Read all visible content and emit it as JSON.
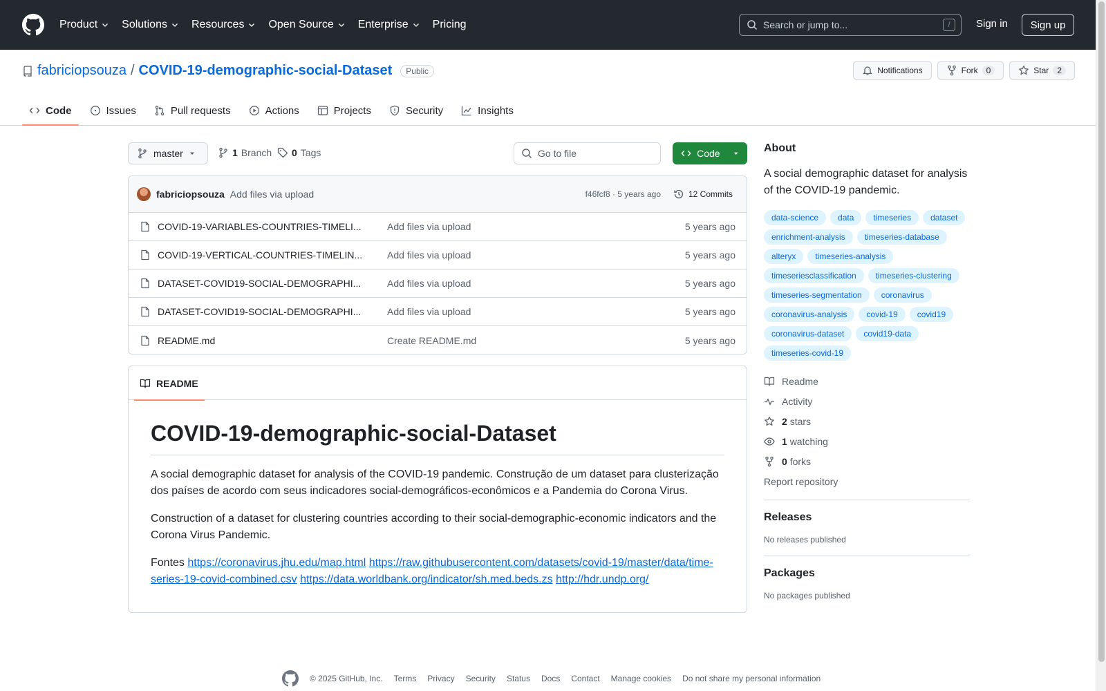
{
  "nav": {
    "items": [
      "Product",
      "Solutions",
      "Resources",
      "Open Source",
      "Enterprise",
      "Pricing"
    ],
    "search_placeholder": "Search or jump to...",
    "search_shortcut": "/",
    "signin": "Sign in",
    "signup": "Sign up"
  },
  "repo": {
    "owner": "fabriciopsouza",
    "separator": "/",
    "name": "COVID-19-demographic-social-Dataset",
    "visibility": "Public",
    "notifications": "Notifications",
    "fork_label": "Fork",
    "fork_count": "0",
    "star_label": "Star",
    "star_count": "2"
  },
  "tabs": [
    "Code",
    "Issues",
    "Pull requests",
    "Actions",
    "Projects",
    "Security",
    "Insights"
  ],
  "toolbar": {
    "branch": "master",
    "branch_count": "1",
    "branch_label": "Branch",
    "tag_count": "0",
    "tag_label": "Tags",
    "goto_placeholder": "Go to file",
    "code_button": "Code"
  },
  "last_commit": {
    "author": "fabriciopsouza",
    "message": "Add files via upload",
    "meta": "f46fcf8 · 5 years ago",
    "commits": "12 Commits"
  },
  "files": [
    {
      "name": "COVID-19-VARIABLES-COUNTRIES-TIMELI...",
      "message": "Add files via upload",
      "time": "5 years ago"
    },
    {
      "name": "COVID-19-VERTICAL-COUNTRIES-TIMELIN...",
      "message": "Add files via upload",
      "time": "5 years ago"
    },
    {
      "name": "DATASET-COVID19-SOCIAL-DEMOGRAPHI...",
      "message": "Add files via upload",
      "time": "5 years ago"
    },
    {
      "name": "DATASET-COVID19-SOCIAL-DEMOGRAPHI...",
      "message": "Add files via upload",
      "time": "5 years ago"
    },
    {
      "name": "README.md",
      "message": "Create README.md",
      "time": "5 years ago"
    }
  ],
  "readme": {
    "tab": "README",
    "title": "COVID-19-demographic-social-Dataset",
    "p1": "A social demographic dataset for analysis of the COVID-19 pandemic. Construção de um dataset para clusterização dos países de acordo com seus indicadores social-demográficos-econômicos e a Pandemia do Corona Virus.",
    "p2": "Construction of a dataset for clustering countries according to their social-demographic-economic indicators and the Corona Virus Pandemic.",
    "p3_prefix": "Fontes",
    "links": [
      "https://coronavirus.jhu.edu/map.html",
      "https://raw.githubusercontent.com/datasets/covid-19/master/data/time-series-19-covid-combined.csv",
      "https://data.worldbank.org/indicator/sh.med.beds.zs",
      "http://hdr.undp.org/"
    ]
  },
  "about": {
    "heading": "About",
    "description": "A social demographic dataset for analysis of the COVID-19 pandemic.",
    "topics": [
      "data-science",
      "data",
      "timeseries",
      "dataset",
      "enrichment-analysis",
      "timeseries-database",
      "alteryx",
      "timeseries-analysis",
      "timeseriesclassification",
      "timeseries-clustering",
      "timeseries-segmentation",
      "coronavirus",
      "coronavirus-analysis",
      "covid-19",
      "covid19",
      "coronavirus-dataset",
      "covid19-data",
      "timeseries-covid-19"
    ],
    "readme": "Readme",
    "activity": "Activity",
    "stars_count": "2",
    "stars_label": "stars",
    "watching_count": "1",
    "watching_label": "watching",
    "forks_count": "0",
    "forks_label": "forks",
    "report": "Report repository"
  },
  "releases": {
    "heading": "Releases",
    "empty": "No releases published"
  },
  "packages": {
    "heading": "Packages",
    "empty": "No packages published"
  },
  "footer": {
    "copyright": "© 2025 GitHub, Inc.",
    "links": [
      "Terms",
      "Privacy",
      "Security",
      "Status",
      "Docs",
      "Contact",
      "Manage cookies",
      "Do not share my personal information"
    ]
  },
  "colors": {
    "header_bg": "#24292f",
    "link": "#0969da",
    "code_button": "#1f883d",
    "topic_bg": "#ddf4ff",
    "tab_underline": "#fd8c73"
  }
}
